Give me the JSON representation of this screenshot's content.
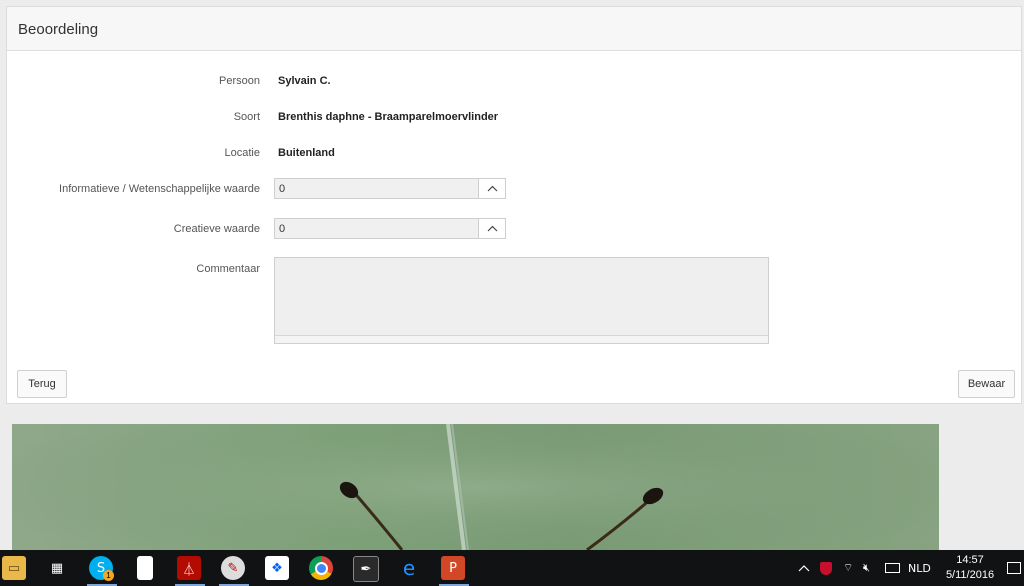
{
  "panel": {
    "title": "Beoordeling"
  },
  "form": {
    "persoon": {
      "label": "Persoon",
      "value": "Sylvain C."
    },
    "soort": {
      "label": "Soort",
      "value": "Brenthis daphne - Braamparelmoervlinder"
    },
    "locatie": {
      "label": "Locatie",
      "value": "Buitenland"
    },
    "informatief": {
      "label": "Informatieve / Wetenschappelijke waarde",
      "value": "0"
    },
    "creatief": {
      "label": "Creatieve waarde",
      "value": "0"
    },
    "commentaar": {
      "label": "Commentaar",
      "value": ""
    }
  },
  "buttons": {
    "back": "Terug",
    "save": "Bewaar"
  },
  "taskbar": {
    "apps": [
      "file-explorer-icon",
      "store-icon",
      "skype-icon",
      "document-icon",
      "acrobat-icon",
      "paint-icon",
      "dropbox-icon",
      "chrome-icon",
      "pen-icon",
      "edge-icon",
      "powerpoint-icon"
    ],
    "skype_badge": "1",
    "language": "NLD",
    "time": "14:57",
    "date": "5/11/2016"
  }
}
